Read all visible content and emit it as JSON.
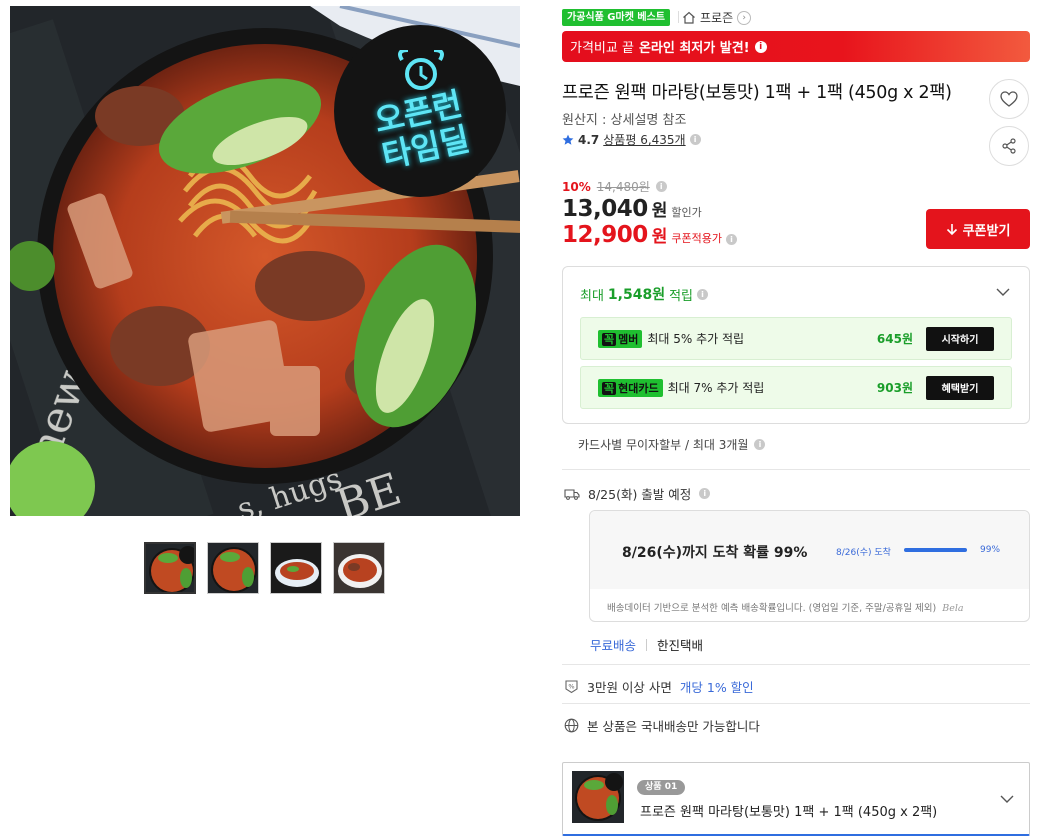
{
  "gallery": {
    "hero_badge_line1": "오픈런",
    "hero_badge_line2": "타임딜",
    "thumb_count": 4
  },
  "header": {
    "best_badge": "가공식품 G마켓 베스트",
    "brand": "프로즌"
  },
  "price_banner": {
    "prefix": "가격비교 끝",
    "highlight": "온라인 최저가 발견!"
  },
  "product": {
    "title": "프로즌 원팩 마라탕(보통맛) 1팩 + 1팩 (450g x 2팩)",
    "origin": "원산지 : 상세설명 참조",
    "rating": "4.7",
    "review_label": "상품평 6,435개"
  },
  "pricing": {
    "discount_rate": "10%",
    "original_price": "14,480원",
    "sale_price": "13,040",
    "sale_unit": "원",
    "sale_label": "할인가",
    "coupon_price": "12,900",
    "coupon_unit": "원",
    "coupon_label": "쿠폰적용가",
    "coupon_button": "쿠폰받기"
  },
  "reward": {
    "head_prefix": "최대",
    "head_amount": "1,548원",
    "head_suffix": "적립",
    "cards": [
      {
        "tag_k": "꼭",
        "tag": "멤버",
        "text": "최대 5% 추가 적립",
        "amount": "645원",
        "button": "시작하기"
      },
      {
        "tag_k": "꼭",
        "tag": "현대카드",
        "text": "최대 7% 추가 적립",
        "amount": "903원",
        "button": "혜택받기"
      }
    ]
  },
  "installment": "카드사별 무이자할부 / 최대 3개월",
  "shipping": {
    "departure": "8/25(화) 출발 예정",
    "predict_main": "8/26(수)까지 도착 확률 99%",
    "predict_small": "8/26(수) 도착",
    "predict_pct": "99%",
    "predict_fill": 0.99,
    "predict_note": "배송데이터 기반으로 분석한 예측 배송확률입니다. (영업일 기준, 주말/공휴일 제외)",
    "predict_brand": "Bela",
    "free_label": "무료배송",
    "carrier": "한진택배"
  },
  "bulk": {
    "prefix": "3만원 이상 사면",
    "highlight": "개당 1% 할인"
  },
  "domestic": "본 상품은 국내배송만 가능합니다",
  "option": {
    "tag": "상품 01",
    "name": "프로즌 원팩 마라탕(보통맛) 1팩 + 1팩 (450g x 2팩)"
  },
  "colors": {
    "accent_red": "#e4141c",
    "green": "#1fbf30",
    "blue": "#3a6ad8"
  }
}
